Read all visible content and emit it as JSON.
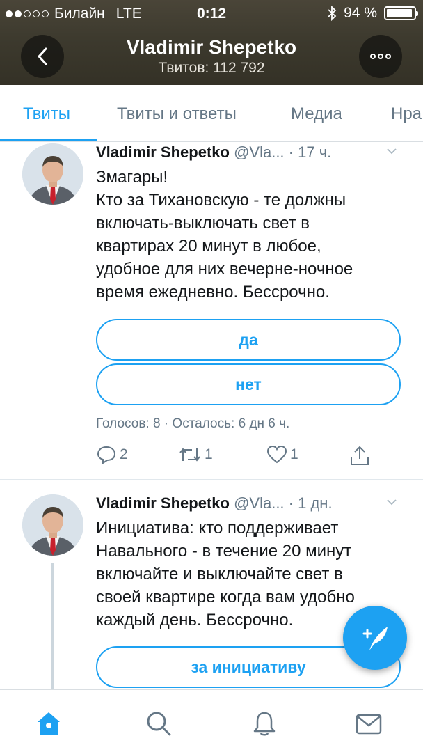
{
  "status_bar": {
    "carrier": "Билайн",
    "network": "LTE",
    "time": "0:12",
    "battery_percent": "94 %",
    "battery_level": 0.94,
    "signal_bars": 2
  },
  "header": {
    "profile_name": "Vladimir Shepetko",
    "tweet_count": "Твитов: 112 792",
    "back_icon": "chevron-left-icon",
    "more_icon": "more-horizontal-icon"
  },
  "tabs": [
    {
      "label": "Твиты",
      "active": true
    },
    {
      "label": "Твиты и ответы",
      "active": false
    },
    {
      "label": "Медиа",
      "active": false
    },
    {
      "label": "Нра",
      "active": false
    }
  ],
  "tweets": [
    {
      "name": "Vladimir Shepetko",
      "handle": "@Vla...",
      "separator": "·",
      "ago": "17 ч.",
      "text": "Змагары!\nКто за Тихановскую - те должны\nвключать-выключать свет в\nквартирах 20 минут в любое,\nудобное для них вечерне-ночное\nвремя ежедневно. Бессрочно.",
      "poll_options": [
        "да",
        "нет"
      ],
      "poll_meta": "Голосов: 8 · Осталось: 6 дн 6 ч.",
      "replies": "2",
      "retweets": "1",
      "likes": "1"
    },
    {
      "name": "Vladimir Shepetko",
      "handle": "@Vla...",
      "separator": "·",
      "ago": "1 дн.",
      "text": "Инициатива: кто поддерживает\nНавального - в течение 20 минут\nвключайте и выключайте свет в\nсвоей квартире когда вам удобно\nкаждый день. Бессрочно.",
      "poll_options": [
        "за инициативу"
      ]
    }
  ],
  "fab": {
    "icon": "compose-tweet-icon"
  },
  "bottom_nav": [
    {
      "icon": "home-icon",
      "active": true
    },
    {
      "icon": "search-icon",
      "active": false
    },
    {
      "icon": "bell-icon",
      "active": false
    },
    {
      "icon": "mail-icon",
      "active": false
    }
  ],
  "colors": {
    "accent": "#1da1f2",
    "secondary_text": "#657786",
    "header_bg": "#3d3a2e"
  }
}
